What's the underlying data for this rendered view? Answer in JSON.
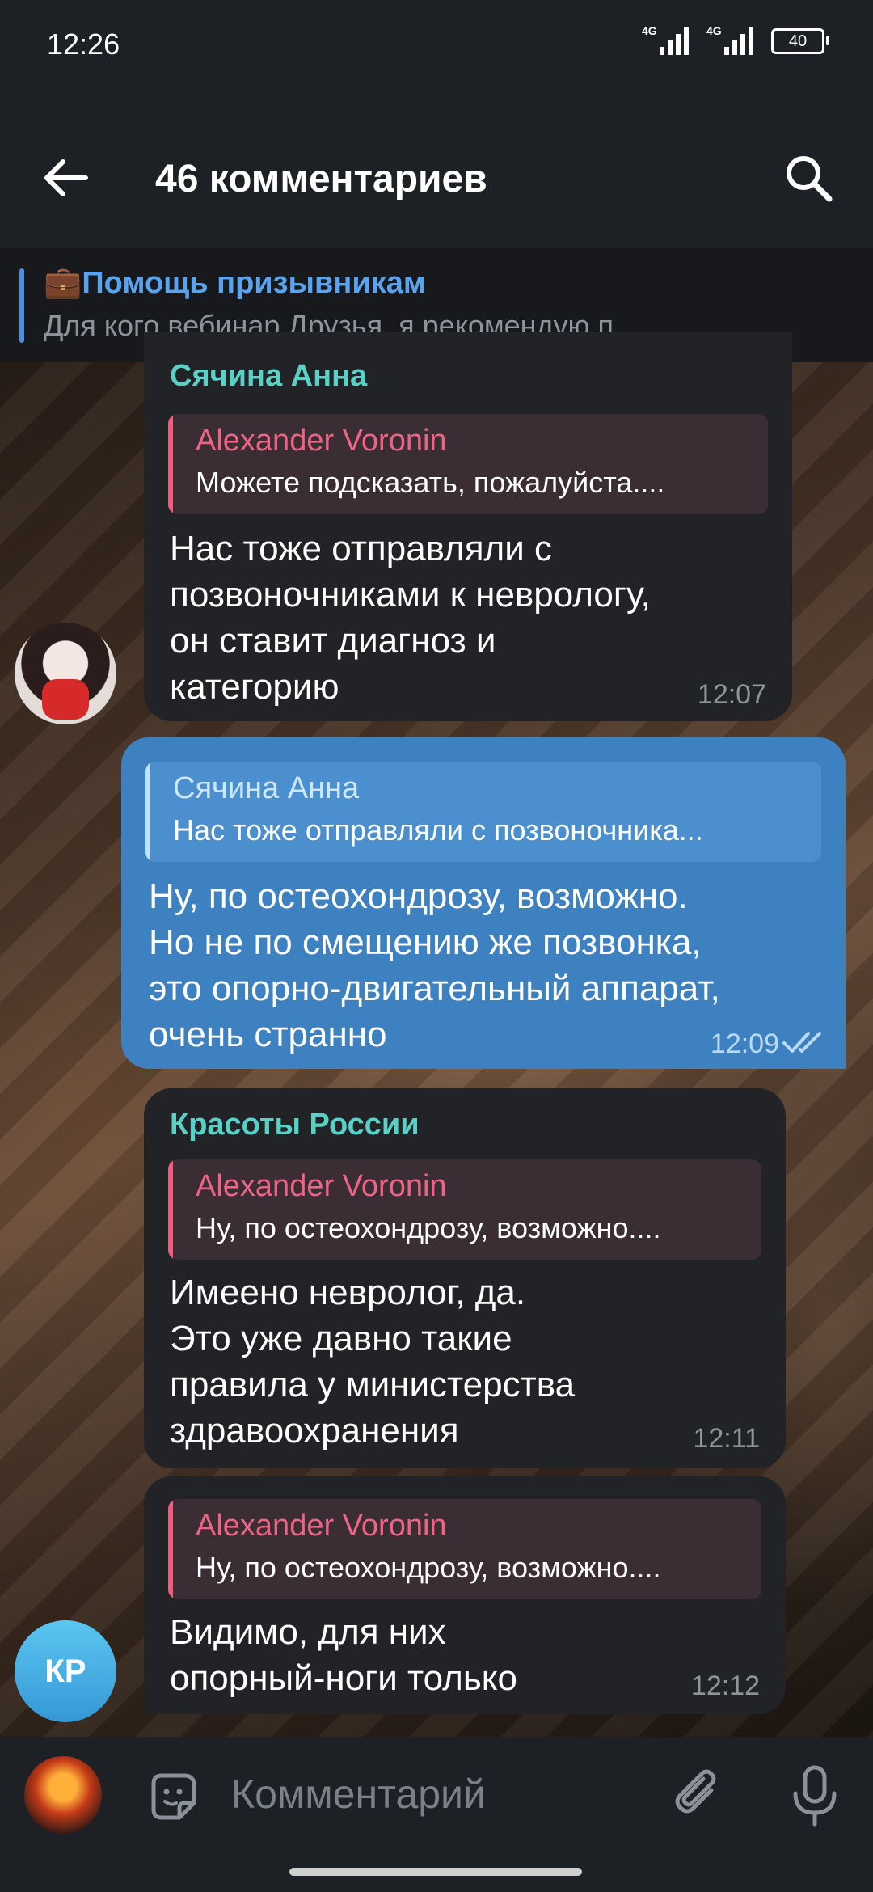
{
  "status_bar": {
    "time": "12:26",
    "sim1": "4G",
    "sim2": "4G",
    "battery": "40"
  },
  "header": {
    "title": "46 комментариев",
    "icons": [
      "arrow-left-icon",
      "search-icon"
    ]
  },
  "pinned": {
    "title": "💼Помощь призывникам",
    "subtitle": "Для кого вебинар  Друзья, я рекомендую п..."
  },
  "messages": [
    {
      "author": "Сячина Анна",
      "reply_name": "Alexander Voronin",
      "reply_text": "Можете подсказать, пожалуйста....",
      "text": "Нас тоже отправляли с\nпозвоночниками к неврологу,\nон ставит диагноз и\nкатегорию",
      "time": "12:07"
    },
    {
      "reply_name": "Сячина Анна",
      "reply_text": "Нас тоже отправляли с позвоночника...",
      "text": "Ну, по остеохондрозу, возможно.\nНо не по смещению же позвонка,\nэто опорно-двигательный аппарат,\nочень странно",
      "time": "12:09"
    },
    {
      "author": "Красоты России",
      "reply_name": "Alexander Voronin",
      "reply_text": "Ну, по остеохондрозу, возможно....",
      "text": "Имеено невролог, да.\nЭто уже давно такие\nправила у министерства\nздравоохранения",
      "time": "12:11"
    },
    {
      "reply_name": "Alexander Voronin",
      "reply_text": "Ну, по остеохондрозу, возможно....",
      "text": "Видимо, для них\nопорный-ноги только",
      "time": "12:12",
      "avatar_initials": "КР"
    }
  ],
  "input": {
    "placeholder": "Комментарий"
  },
  "colors": {
    "accent": "#5aa3ee",
    "outgoing": "#3e81c0",
    "reply_name": "#ee6486",
    "author_teal": "#5ad1c6"
  }
}
